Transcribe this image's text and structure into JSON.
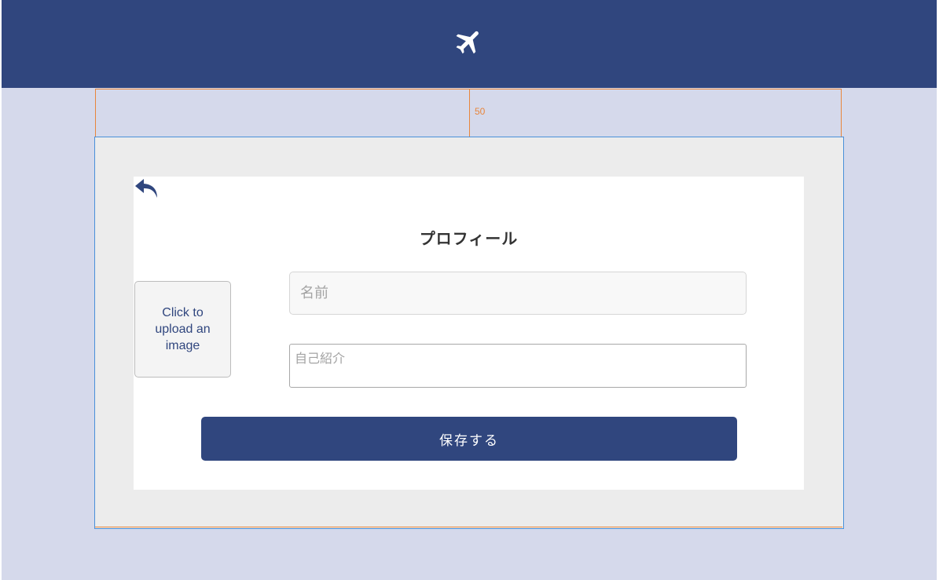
{
  "header": {
    "logo_icon": "airplane-icon",
    "background_color": "#30467e"
  },
  "guide": {
    "margin_label": "50",
    "color": "#e8863c"
  },
  "profile": {
    "back_icon": "back-arrow-icon",
    "title": "プロフィール",
    "upload_label": "Click to upload an image",
    "name_placeholder": "名前",
    "name_value": "",
    "bio_placeholder": "自己紹介",
    "bio_value": "",
    "save_label": "保存する"
  },
  "colors": {
    "accent": "#30467e",
    "page_background": "#d5d9eb",
    "frame_background": "#ececec",
    "card_background": "#ffffff"
  }
}
